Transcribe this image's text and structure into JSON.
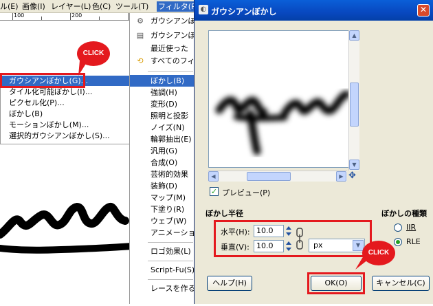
{
  "menubar": {
    "items": [
      "ル(E)",
      "画像(I)",
      "レイヤー(L)",
      "色(C)",
      "ツール(T)",
      "フィルタ(R)"
    ]
  },
  "ruler": {
    "label_a": "100",
    "label_b": "200"
  },
  "blur_submenu": {
    "items": [
      "ガウシアンぼかし(G)...",
      "タイル化可能ぼかし(I)...",
      "ピクセル化(P)...",
      "ぼかし(B)",
      "モーションぼかし(M)...",
      "選択的ガウシアンぼかし(S)..."
    ]
  },
  "filter_menu": {
    "recent": [
      "ガウシアンぼ",
      "ガウシアンぼ",
      "最近使った",
      "すべてのフィ"
    ],
    "categories": [
      "ぼかし(B)",
      "強調(H)",
      "変形(D)",
      "照明と投影",
      "ノイズ(N)",
      "輪郭抽出(E)",
      "汎用(G)",
      "合成(O)",
      "芸術的効果",
      "装飾(D)",
      "マップ(M)",
      "下塗り(R)",
      "ウェブ(W)",
      "アニメーション"
    ],
    "extra": [
      "ロゴ効果(L)",
      "Script-Fu(S)",
      "レースを作る"
    ]
  },
  "callouts": {
    "left_click": "CLICK",
    "right_click": "CLICK"
  },
  "dialog": {
    "title": "ガウシアンぼかし",
    "preview_label": "プレビュー(P)",
    "radius_heading": "ぼかし半径",
    "horizontal_label": "水平(H):",
    "horizontal_value": "10.0",
    "vertical_label": "垂直(V):",
    "vertical_value": "10.0",
    "unit_value": "px",
    "method_heading": "ぼかしの種類",
    "method_iir": "IIR",
    "method_rle": "RLE",
    "method_selected": "RLE",
    "help_button": "ヘルプ(H)",
    "ok_button": "OK(O)",
    "cancel_button": "キャンセル(C)"
  },
  "colors": {
    "accent": "#316ac5",
    "callout": "#e4191e",
    "titlebar": "#0848c0"
  }
}
